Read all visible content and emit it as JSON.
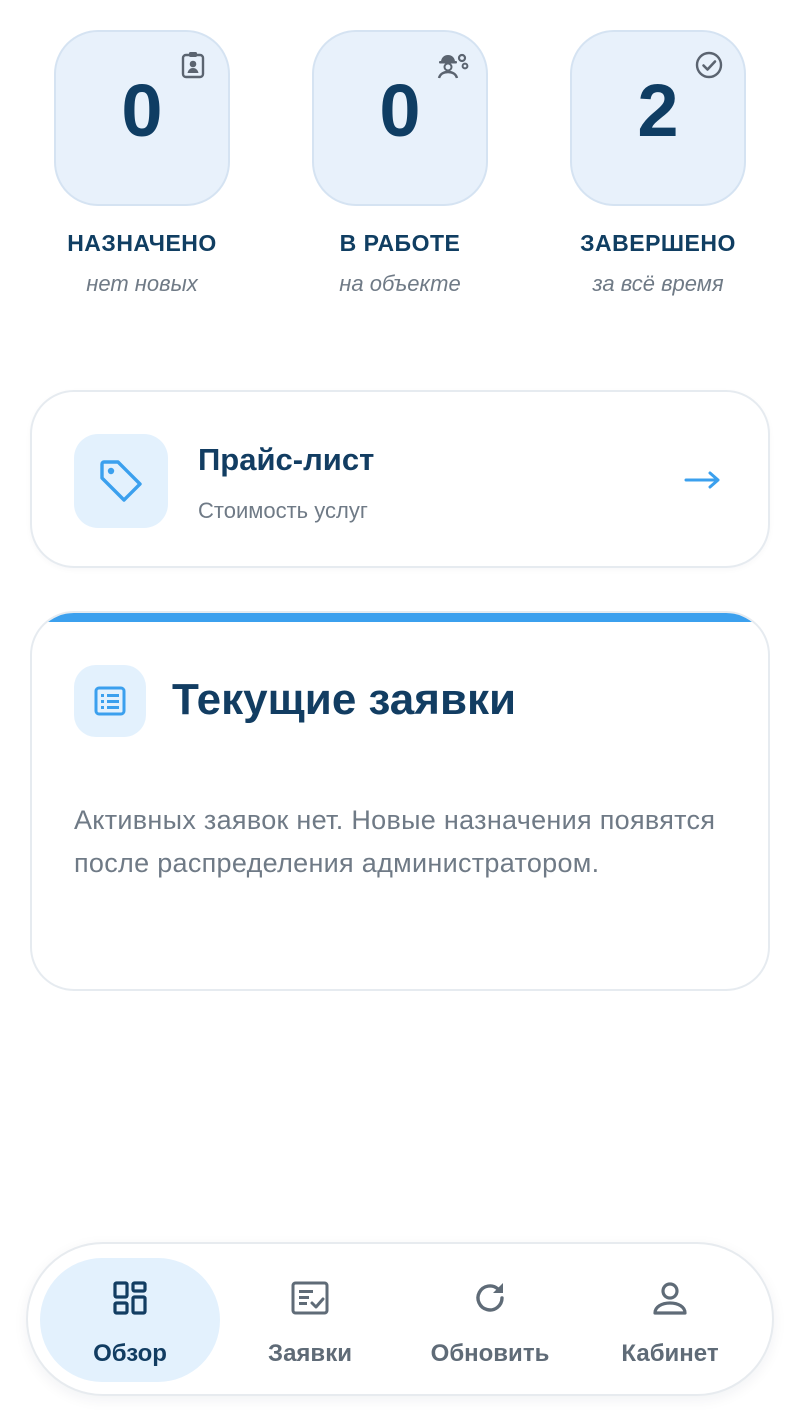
{
  "stats": [
    {
      "value": "0",
      "label": "НАЗНАЧЕНО",
      "sub": "нет новых",
      "icon": "badge-icon"
    },
    {
      "value": "0",
      "label": "В РАБОТЕ",
      "sub": "на объекте",
      "icon": "worker-gear-icon"
    },
    {
      "value": "2",
      "label": "ЗАВЕРШЕНО",
      "sub": "за всё время",
      "icon": "check-circle-icon"
    }
  ],
  "price_card": {
    "title": "Прайс-лист",
    "subtitle": "Стоимость услуг",
    "icon": "tag-icon"
  },
  "orders_card": {
    "title": "Текущие заявки",
    "empty_text": "Активных заявок нет. Новые назначения появятся после распределения администратором.",
    "icon": "list-icon",
    "accent": "#3ba0ee"
  },
  "nav": [
    {
      "label": "Обзор",
      "icon": "dashboard-icon",
      "active": true
    },
    {
      "label": "Заявки",
      "icon": "checklist-icon",
      "active": false
    },
    {
      "label": "Обновить",
      "icon": "refresh-icon",
      "active": false
    },
    {
      "label": "Кабинет",
      "icon": "user-icon",
      "active": false
    }
  ],
  "colors": {
    "primary_text": "#123d62",
    "accent": "#3ba0ee",
    "tile_bg": "#e8f1fb",
    "muted_text": "#6f7a86"
  }
}
